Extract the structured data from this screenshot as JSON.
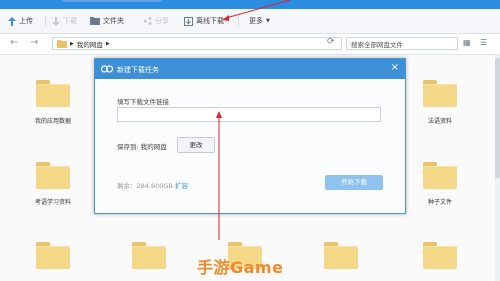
{
  "toolbar": {
    "upload": "上传",
    "download": "下载",
    "new_folder": "文件夹",
    "share": "分享",
    "offline_download": "离线下载",
    "more": "更多"
  },
  "nav": {
    "path_root": "我的网盘",
    "search_placeholder": "搜索全部网盘文件"
  },
  "folders": {
    "my_app_data": "我的应用数据",
    "law_materials": "法语资料",
    "kaoyan_materials": "考语学习资料",
    "seed_files": "种子文件"
  },
  "dialog": {
    "title": "新建下载任务",
    "url_label": "填写下载文件链接",
    "url_value": "",
    "save_to_label": "保存到: 我的网盘",
    "change_button": "更改",
    "remaining": "剩余：284.600GB",
    "expand_link": "扩容",
    "start_button": "开始下载"
  },
  "watermark": "手游Game",
  "colors": {
    "accent": "#3d8fd6",
    "folder": "#f5d887",
    "annotation_arrow": "#d9222a",
    "watermark": "#f2892a"
  }
}
